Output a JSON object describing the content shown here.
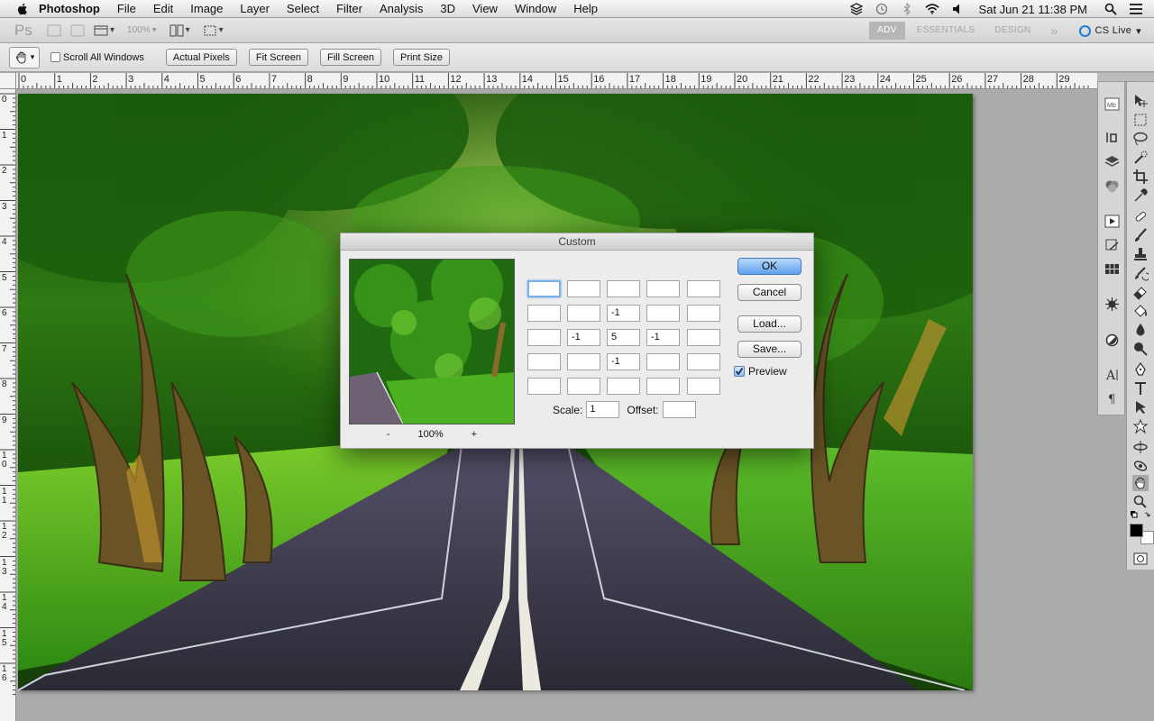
{
  "menubar": {
    "app_name": "Photoshop",
    "items": [
      "File",
      "Edit",
      "Image",
      "Layer",
      "Select",
      "Filter",
      "Analysis",
      "3D",
      "View",
      "Window",
      "Help"
    ],
    "clock": "Sat Jun 21  11:38 PM"
  },
  "appbar": {
    "logo": "Ps",
    "zoom": "100%",
    "workspaces": [
      "ADV",
      "ESSENTIALS",
      "DESIGN"
    ],
    "more": "»",
    "cslive": "CS Live"
  },
  "options": {
    "scroll_all": "Scroll All Windows",
    "buttons": [
      "Actual Pixels",
      "Fit Screen",
      "Fill Screen",
      "Print Size"
    ]
  },
  "rulers": {
    "top": [
      "0",
      "1",
      "2",
      "3",
      "4",
      "5",
      "6",
      "7",
      "8",
      "9",
      "10",
      "11",
      "12",
      "13",
      "14",
      "15",
      "16",
      "17",
      "18",
      "19",
      "20",
      "21",
      "22",
      "23",
      "24",
      "25",
      "26",
      "27",
      "28",
      "29"
    ],
    "left": [
      "0",
      "1",
      "2",
      "3",
      "4",
      "5",
      "6",
      "7",
      "8",
      "9",
      "1 0",
      "1 1",
      "1 2",
      "1 3",
      "1 4",
      "1 5",
      "1 6"
    ]
  },
  "dialog": {
    "title": "Custom",
    "zoom_minus": "-",
    "zoom_value": "100%",
    "zoom_plus": "+",
    "matrix": [
      [
        "",
        "",
        "",
        "",
        ""
      ],
      [
        "",
        "",
        "-1",
        "",
        ""
      ],
      [
        "",
        "-1",
        "5",
        "-1",
        ""
      ],
      [
        "",
        "",
        "-1",
        "",
        ""
      ],
      [
        "",
        "",
        "",
        "",
        ""
      ]
    ],
    "scale_label": "Scale:",
    "scale_value": "1",
    "offset_label": "Offset:",
    "offset_value": "",
    "ok": "OK",
    "cancel": "Cancel",
    "load": "Load...",
    "save": "Save...",
    "preview_label": "Preview",
    "preview_checked": true
  },
  "colors": {
    "accent": "#5fa0ee",
    "canvas_bg": "#ababab"
  }
}
